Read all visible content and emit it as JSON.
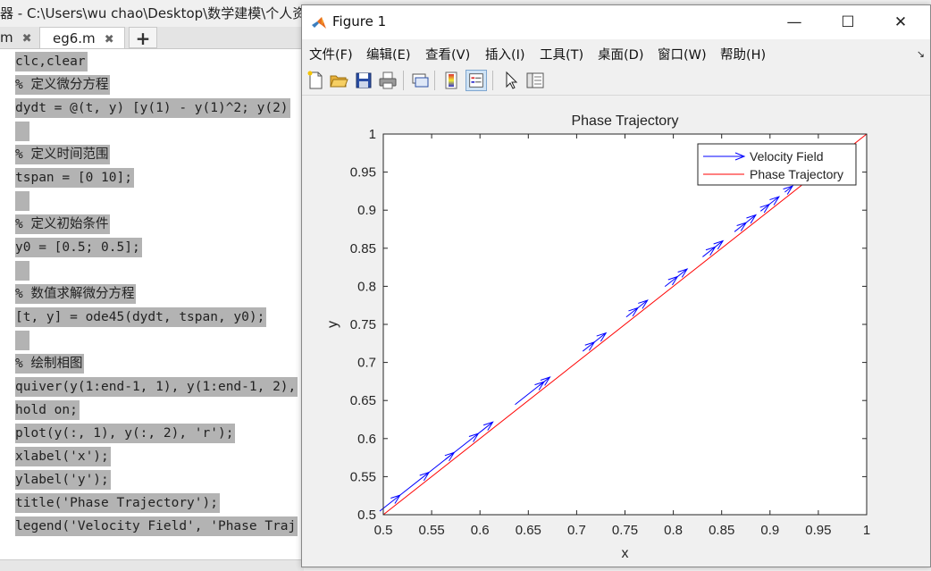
{
  "editor": {
    "title": "器 - C:\\Users\\wu chao\\Desktop\\数学建模\\个人资",
    "tabs": [
      {
        "label": "m",
        "close": "✖"
      },
      {
        "label": "eg6.m",
        "close": "✖"
      }
    ],
    "add_tab": "+",
    "lines": [
      "clc,clear",
      "% 定义微分方程",
      "dydt = @(t, y) [y(1) - y(1)^2; y(2)",
      "",
      "% 定义时间范围",
      "tspan = [0 10];",
      "",
      "% 定义初始条件",
      "y0 = [0.5; 0.5];",
      "",
      "% 数值求解微分方程",
      "[t, y] = ode45(dydt, tspan, y0);",
      "",
      "% 绘制相图",
      "quiver(y(1:end-1, 1), y(1:end-1, 2),",
      "hold on;",
      "plot(y(:, 1), y(:, 2), 'r');",
      "xlabel('x');",
      "ylabel('y');",
      "title('Phase Trajectory');",
      "legend('Velocity Field', 'Phase Traj"
    ]
  },
  "figure": {
    "title": "Figure 1",
    "window_buttons": {
      "minimize": "—",
      "maximize": "☐",
      "close": "✕"
    },
    "menus": [
      "文件(F)",
      "编辑(E)",
      "查看(V)",
      "插入(I)",
      "工具(T)",
      "桌面(D)",
      "窗口(W)",
      "帮助(H)"
    ],
    "menu_overflow": "↘",
    "toolbar": [
      "new-figure-icon",
      "open-file-icon",
      "save-icon",
      "print-icon",
      "link-plot-icon",
      "colorbar-icon",
      "legend-icon",
      "pointer-icon",
      "property-editor-icon"
    ]
  },
  "chart_data": {
    "type": "line",
    "title": "Phase Trajectory",
    "xlabel": "x",
    "ylabel": "y",
    "xlim": [
      0.5,
      1
    ],
    "ylim": [
      0.5,
      1
    ],
    "xticks": [
      "0.5",
      "0.55",
      "0.6",
      "0.65",
      "0.7",
      "0.75",
      "0.8",
      "0.85",
      "0.9",
      "0.95",
      "1"
    ],
    "yticks": [
      "0.5",
      "0.55",
      "0.6",
      "0.65",
      "0.7",
      "0.75",
      "0.8",
      "0.85",
      "0.9",
      "0.95",
      "1"
    ],
    "legend_position": "top-right",
    "grid": false,
    "series": [
      {
        "name": "Velocity Field",
        "type": "quiver",
        "color": "#0000ff",
        "points": [
          {
            "x": 0.5,
            "y": 0.5,
            "u": 0.021,
            "v": 0.021
          },
          {
            "x": 0.521,
            "y": 0.521,
            "u": 0.03,
            "v": 0.03
          },
          {
            "x": 0.547,
            "y": 0.547,
            "u": 0.03,
            "v": 0.03
          },
          {
            "x": 0.568,
            "y": 0.568,
            "u": 0.034,
            "v": 0.034
          },
          {
            "x": 0.6,
            "y": 0.6,
            "u": 0.017,
            "v": 0.017
          },
          {
            "x": 0.64,
            "y": 0.64,
            "u": 0.03,
            "v": 0.03
          },
          {
            "x": 0.665,
            "y": 0.665,
            "u": 0.011,
            "v": 0.011
          },
          {
            "x": 0.71,
            "y": 0.71,
            "u": 0.012,
            "v": 0.012
          },
          {
            "x": 0.72,
            "y": 0.72,
            "u": 0.014,
            "v": 0.014
          },
          {
            "x": 0.755,
            "y": 0.755,
            "u": 0.012,
            "v": 0.012
          },
          {
            "x": 0.767,
            "y": 0.767,
            "u": 0.01,
            "v": 0.01
          },
          {
            "x": 0.795,
            "y": 0.795,
            "u": 0.013,
            "v": 0.013
          },
          {
            "x": 0.808,
            "y": 0.808,
            "u": 0.01,
            "v": 0.01
          },
          {
            "x": 0.834,
            "y": 0.834,
            "u": 0.013,
            "v": 0.013
          },
          {
            "x": 0.845,
            "y": 0.845,
            "u": 0.01,
            "v": 0.01
          },
          {
            "x": 0.867,
            "y": 0.867,
            "u": 0.012,
            "v": 0.012
          },
          {
            "x": 0.879,
            "y": 0.879,
            "u": 0.01,
            "v": 0.01
          },
          {
            "x": 0.894,
            "y": 0.894,
            "u": 0.009,
            "v": 0.009
          },
          {
            "x": 0.903,
            "y": 0.903,
            "u": 0.01,
            "v": 0.01
          },
          {
            "x": 0.919,
            "y": 0.919,
            "u": 0.008,
            "v": 0.008
          }
        ]
      },
      {
        "name": "Phase Trajectory",
        "type": "line",
        "color": "#ff0000",
        "x": [
          0.5,
          1.0
        ],
        "y": [
          0.5,
          1.0
        ]
      }
    ]
  }
}
